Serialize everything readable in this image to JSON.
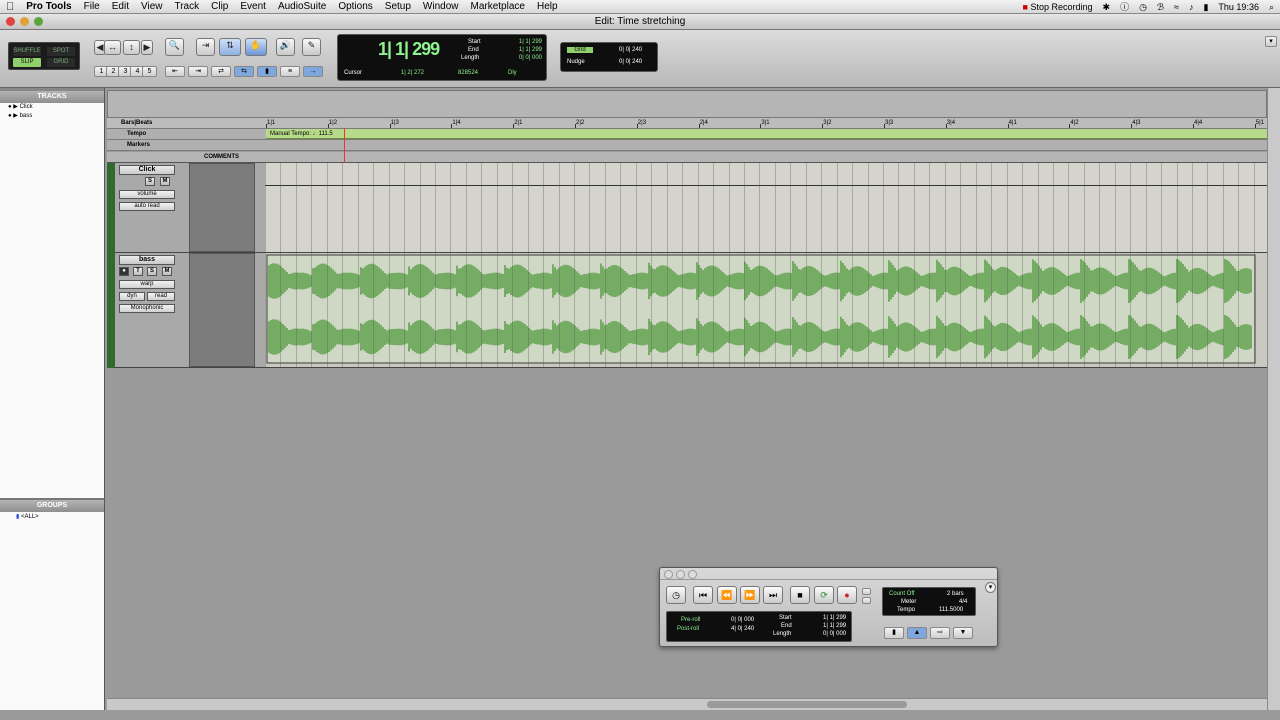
{
  "menubar": {
    "app": "Pro Tools",
    "items": [
      "File",
      "Edit",
      "View",
      "Track",
      "Clip",
      "Event",
      "AudioSuite",
      "Options",
      "Setup",
      "Window",
      "Marketplace",
      "Help"
    ],
    "stop_recording": "Stop Recording",
    "clock": "Thu 19:36"
  },
  "window": {
    "title": "Edit: Time stretching"
  },
  "modes": {
    "shuffle": "SHUFFLE",
    "spot": "SPOT",
    "slip": "SLIP",
    "grid": "GRID"
  },
  "zoom_presets": [
    "1",
    "2",
    "3",
    "4",
    "5"
  ],
  "counter": {
    "main": "1| 1| 299",
    "start_label": "Start",
    "end_label": "End",
    "length_label": "Length",
    "start": "1| 1| 299",
    "end": "1| 1| 299",
    "length": "0| 0| 000",
    "cursor_label": "Cursor",
    "cursor": "1| 2| 272",
    "sample": "828524",
    "dly": "Dly"
  },
  "grid_nudge": {
    "grid_label": "Grid",
    "grid_value": "0| 0| 240",
    "nudge_label": "Nudge",
    "nudge_value": "0| 0| 240"
  },
  "tracks_panel": {
    "header": "TRACKS",
    "items": [
      "Click",
      "bass"
    ]
  },
  "groups_panel": {
    "header": "GROUPS",
    "items": [
      "<ALL>"
    ]
  },
  "rulers": {
    "bars_beats": "Bars|Beats",
    "tempo": "Tempo",
    "markers": "Markers",
    "manual_tempo": "Manual Tempo: ♩111.5",
    "comments": "COMMENTS"
  },
  "bar_labels": [
    "1|1",
    "1|2",
    "1|3",
    "1|4",
    "2|1",
    "2|2",
    "2|3",
    "2|4",
    "3|1",
    "3|2",
    "3|3",
    "3|4",
    "4|1",
    "4|2",
    "4|3",
    "4|4",
    "5|1"
  ],
  "click_track": {
    "name": "Click",
    "s": "S",
    "m": "M",
    "view": "volume",
    "auto": "auto read"
  },
  "bass_track": {
    "name": "bass",
    "t": "T",
    "s": "S",
    "m": "M",
    "view": "warp",
    "dyn": "dyn",
    "auto": "read",
    "plugin": "Monophonic"
  },
  "transport": {
    "preroll_label": "Pre-roll",
    "postroll_label": "Post-roll",
    "preroll": "0| 0| 000",
    "postroll": "4| 0| 240",
    "start_label": "Start",
    "end_label": "End",
    "length_label": "Length",
    "start": "1| 1| 299",
    "end": "1| 1| 299",
    "length": "0| 0| 000",
    "countoff_label": "Count Off",
    "countoff": "2 bars",
    "meter_label": "Meter",
    "meter": "4/4",
    "tempo_label": "Tempo",
    "tempo": "111.5000"
  },
  "colors": {
    "accent": "#8fd06b",
    "waveform": "#4f9a3a",
    "counter_text": "#8ff08f"
  }
}
